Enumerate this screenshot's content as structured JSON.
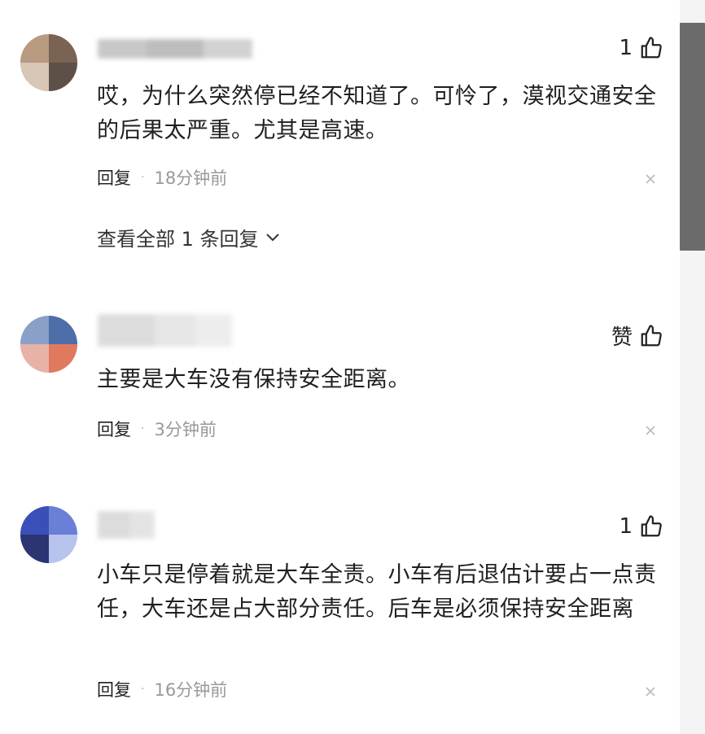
{
  "comments": [
    {
      "likes": "1",
      "text": "哎，为什么突然停已经不知道了。可怜了，漠视交通安全的后果太严重。尤其是高速。",
      "reply_label": "回复",
      "separator": "·",
      "time": "18分钟前",
      "view_all": "查看全部 1 条回复"
    },
    {
      "likes": "赞",
      "text": "主要是大车没有保持安全距离。",
      "reply_label": "回复",
      "separator": "·",
      "time": "3分钟前"
    },
    {
      "likes": "1",
      "text": "小车只是停着就是大车全责。小车有后退估计要占一点责任，大车还是占大部分责任。后车是必须保持安全距离",
      "reply_label": "回复",
      "separator": "·",
      "time": "16分钟前"
    }
  ],
  "colors": {
    "text": "#1f1f1f",
    "meta": "#999999",
    "scrollbar": "#6b6b6b"
  },
  "icons": {
    "like": "thumbs-up-icon",
    "close": "close-icon",
    "expand": "chevron-down-icon"
  }
}
